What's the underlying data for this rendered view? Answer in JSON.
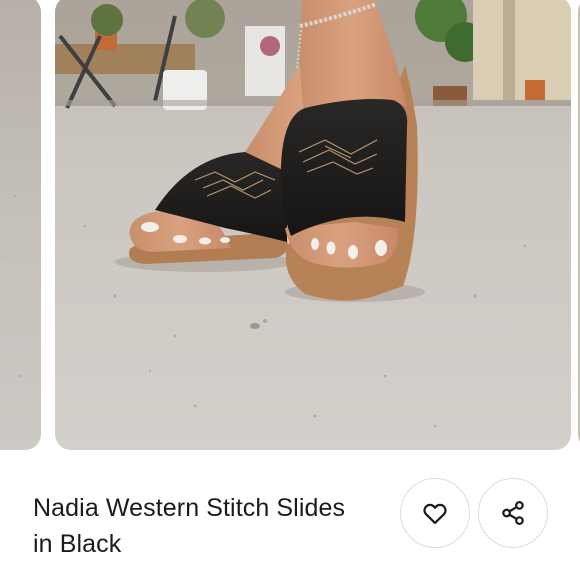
{
  "product": {
    "title_line1": "Nadia Western Stitch Slides",
    "title_line2": "in Black"
  },
  "icons": {
    "favorite": "heart-icon",
    "share": "share-icon"
  },
  "colors": {
    "slide_black": "#1e1e1e",
    "stitch": "#c9a57a",
    "sole": "#b07d52",
    "floor": "#c9c5c0"
  }
}
